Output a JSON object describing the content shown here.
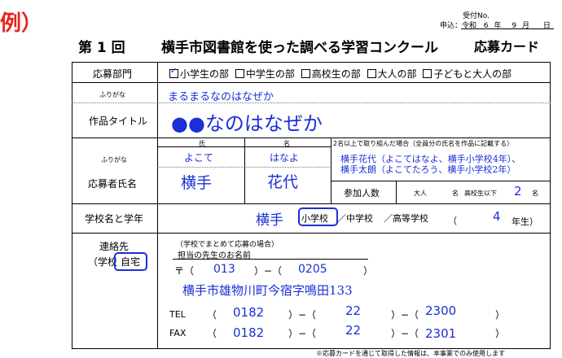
{
  "example_mark": "例）",
  "receipt": {
    "label": "受付No.",
    "date_label": "申込：令和",
    "era_year": "6",
    "year_unit": "年",
    "month": "9",
    "month_unit": "月",
    "day_unit": "日"
  },
  "title": {
    "round": "第 1 回",
    "main": "横手市図書館を使った調べる学習コンクール",
    "card": "応募カード"
  },
  "division": {
    "label": "応募部門",
    "options": [
      {
        "label": "小学生の部",
        "checked": true
      },
      {
        "label": "中学生の部",
        "checked": false
      },
      {
        "label": "高校生の部",
        "checked": false
      },
      {
        "label": "大人の部",
        "checked": false
      },
      {
        "label": "子どもと大人の部",
        "checked": false
      }
    ]
  },
  "work": {
    "furigana_label": "ふりがな",
    "furigana_value": "まるまるなのはなぜか",
    "title_label": "作品タイトル",
    "title_value": "●●なのはなぜか"
  },
  "applicant": {
    "furigana_label": "ふりがな",
    "name_label": "応募者氏名",
    "surname_header": "氏",
    "given_header": "名",
    "surname_furigana": "よこて",
    "given_furigana": "はなよ",
    "surname": "横手",
    "given_name": "花代",
    "group_note": "2名以上で取り組んだ場合（全員分の氏名を作品に記載する）",
    "group_members": [
      "横手花代（よこてはなよ、横手小学校4年）、",
      "横手太朗（よこてたろう、横手小学校2年）"
    ],
    "participants_label": "参加人数",
    "adults_label": "大人",
    "adults_unit": "名",
    "children_label": "高校生以下",
    "children_count": "2",
    "children_unit": "名"
  },
  "school": {
    "label": "学校名と学年",
    "name": "横手",
    "types": [
      "小学校",
      "／中学校",
      "／高等学校"
    ],
    "grade_open": "（",
    "grade": "4",
    "grade_unit": "年生）"
  },
  "contact": {
    "label": "連絡先",
    "school_prefix": "（学校",
    "home": "自宅",
    "school_note": "（学校でまとめて応募の場合）",
    "teacher_label": "担当の先生のお名前",
    "postal_mark": "〒（",
    "postal_1": "013",
    "postal_sep": "）−（",
    "postal_2": "0205",
    "postal_close": "）",
    "address": "横手市雄物川町今宿字鳴田133",
    "tel_label": "TEL",
    "tel": [
      "0182",
      "22",
      "2300"
    ],
    "fax_label": "FAX",
    "fax": [
      "0182",
      "22",
      "2301"
    ],
    "paren_open": "（",
    "paren_sep": "）−（",
    "paren_close": "）"
  },
  "footer_note": "※応募カードを通じて取得した情報は、本事業でのみ使用します"
}
